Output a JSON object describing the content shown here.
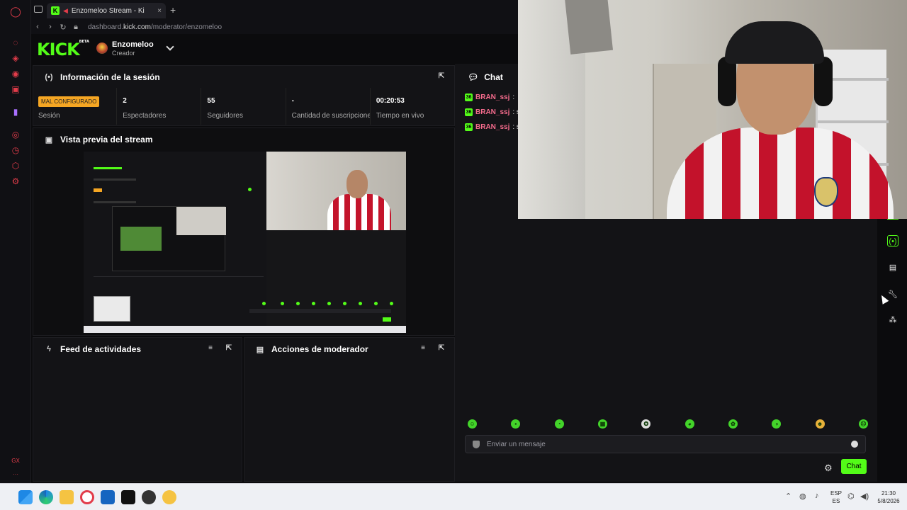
{
  "browser": {
    "tab_title": "Enzomeloo Stream - Ki",
    "tab_close": "×",
    "new_tab": "+",
    "url_prefix": "dashboard.",
    "url_domain": "kick.com",
    "url_path": "/moderator/enzomeloo"
  },
  "header": {
    "logo": "KICK",
    "logo_beta": "BETA",
    "channel_name": "Enzomeloo",
    "channel_role": "Creador"
  },
  "session": {
    "title": "Información de la sesión",
    "status_badge": "MAL CONFIGURADO",
    "status_label": "Sesión",
    "stats": [
      {
        "value": "2",
        "label": "Espectadores"
      },
      {
        "value": "55",
        "label": "Seguidores"
      },
      {
        "value": "-",
        "label": "Cantidad de suscripciones"
      },
      {
        "value": "00:20:53",
        "label": "Tiempo en vivo"
      }
    ]
  },
  "preview": {
    "title": "Vista previa del stream"
  },
  "activity_feed": {
    "title": "Feed de actividades"
  },
  "mod_actions": {
    "title": "Acciones de moderador"
  },
  "chat": {
    "title": "Chat",
    "messages": [
      {
        "badge": "36",
        "user": "BRAN_ssj",
        "text": ":"
      },
      {
        "badge": "36",
        "user": "BRAN_ssj",
        "text": ": se"
      },
      {
        "badge": "36",
        "user": "BRAN_ssj",
        "text": ": sig"
      }
    ],
    "input_placeholder": "Enviar un mensaje",
    "send_label": "Chat"
  },
  "colors": {
    "kick_green": "#53fc18",
    "warning": "#f5a623",
    "username": "#f46b8c"
  },
  "taskbar": {
    "lang": "ESP",
    "lang_sub": "ES",
    "time": "21:30",
    "date": "5/8/2026"
  }
}
